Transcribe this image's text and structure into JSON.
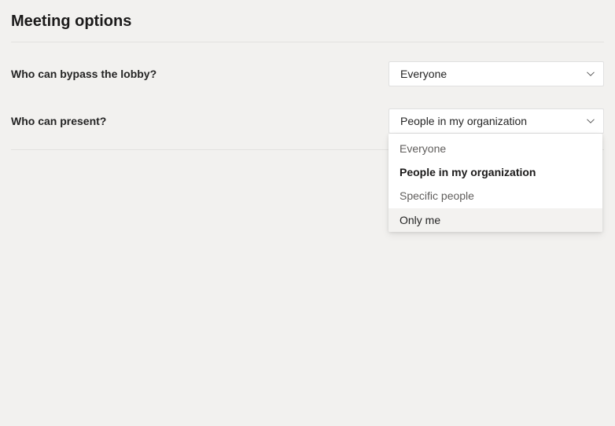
{
  "title": "Meeting options",
  "rows": {
    "lobby": {
      "label": "Who can bypass the lobby?",
      "value": "Everyone"
    },
    "present": {
      "label": "Who can present?",
      "value": "People in my organization",
      "options": [
        "Everyone",
        "People in my organization",
        "Specific people",
        "Only me"
      ]
    }
  }
}
